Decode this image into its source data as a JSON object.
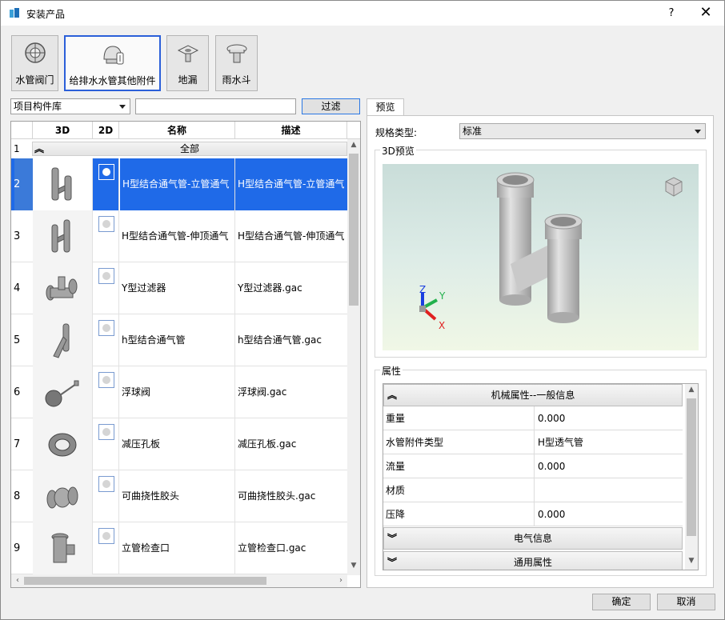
{
  "window": {
    "title": "安装产品",
    "help_label": "?",
    "close_label": "✕"
  },
  "toolbar": {
    "buttons": [
      {
        "label": "水管阀门",
        "icon": "valve-icon"
      },
      {
        "label": "给排水水管其他附件",
        "icon": "pipe-fitting-icon",
        "active": true
      },
      {
        "label": "地漏",
        "icon": "floor-drain-icon"
      },
      {
        "label": "雨水斗",
        "icon": "roof-drain-icon"
      }
    ]
  },
  "library": {
    "selected": "项目构件库",
    "filter_value": "",
    "filter_label": "过滤"
  },
  "table": {
    "headers": {
      "col3d": "3D",
      "col2d": "2D",
      "name": "名称",
      "desc": "描述"
    },
    "group": {
      "num": "1",
      "label": "全部"
    },
    "rows": [
      {
        "num": "2",
        "name": "H型结合通气管-立管通气",
        "desc": "H型结合通气管-立管通气",
        "selected": true
      },
      {
        "num": "3",
        "name": "H型结合通气管-伸顶通气",
        "desc": "H型结合通气管-伸顶通气"
      },
      {
        "num": "4",
        "name": "Y型过滤器",
        "desc": "Y型过滤器.gac"
      },
      {
        "num": "5",
        "name": "h型结合通气管",
        "desc": "h型结合通气管.gac"
      },
      {
        "num": "6",
        "name": "浮球阀",
        "desc": "浮球阀.gac"
      },
      {
        "num": "7",
        "name": "减压孔板",
        "desc": "减压孔板.gac"
      },
      {
        "num": "8",
        "name": "可曲挠性胶头",
        "desc": "可曲挠性胶头.gac"
      },
      {
        "num": "9",
        "name": "立管检查口",
        "desc": "立管检查口.gac"
      }
    ]
  },
  "preview_tab": {
    "label": "预览"
  },
  "spec": {
    "label": "规格类型:",
    "value": "标准"
  },
  "preview": {
    "title": "3D预览",
    "axis_x": "X",
    "axis_y": "Y",
    "axis_z": "Z"
  },
  "properties": {
    "title": "属性",
    "sections": [
      {
        "label": "机械属性--一般信息",
        "expanded": true
      },
      {
        "label": "电气信息",
        "expanded": false
      },
      {
        "label": "通用属性",
        "expanded": false
      }
    ],
    "rows": [
      {
        "key": "重量",
        "value": "0.000"
      },
      {
        "key": "水管附件类型",
        "value": "H型透气管"
      },
      {
        "key": "流量",
        "value": "0.000"
      },
      {
        "key": "材质",
        "value": ""
      },
      {
        "key": "压降",
        "value": "0.000"
      }
    ]
  },
  "footer": {
    "ok_label": "确定",
    "cancel_label": "取消"
  }
}
